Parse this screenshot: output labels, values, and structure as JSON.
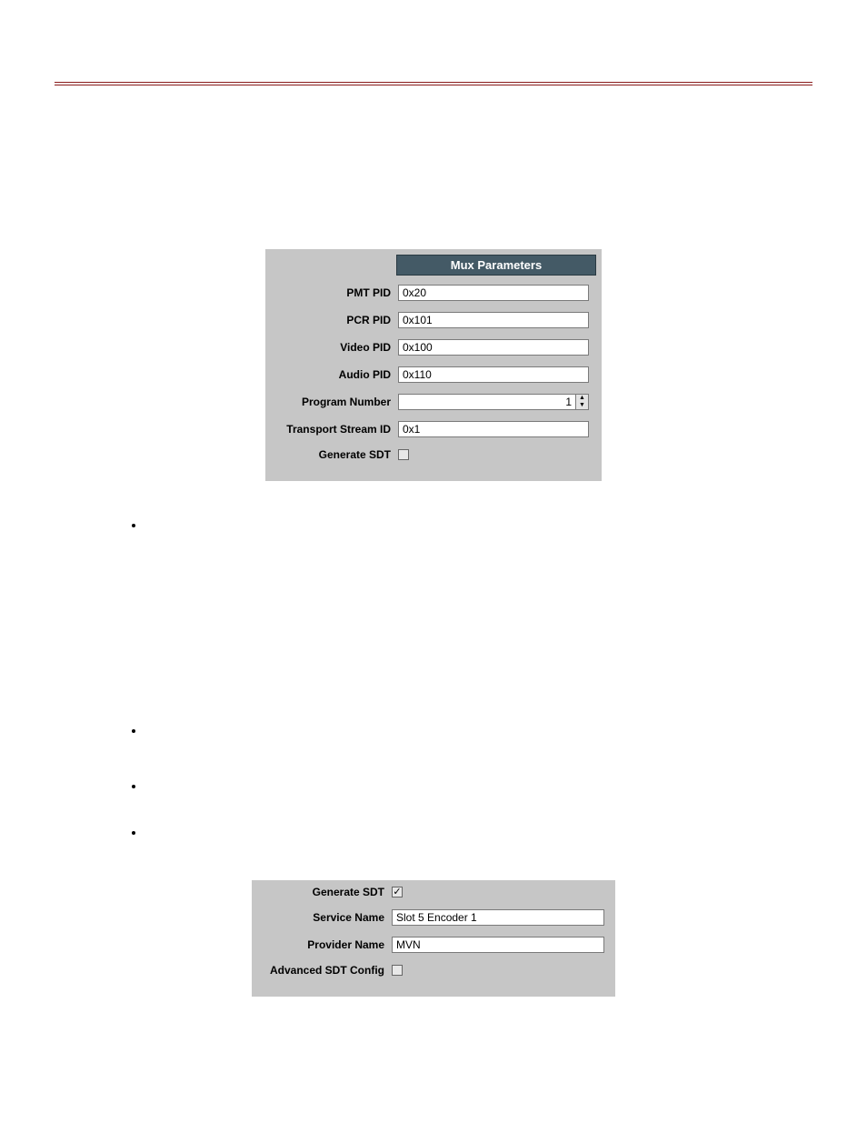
{
  "panel1": {
    "header": "Mux Parameters",
    "rows": {
      "pmt_pid": {
        "label": "PMT PID",
        "value": "0x20"
      },
      "pcr_pid": {
        "label": "PCR PID",
        "value": "0x101"
      },
      "video_pid": {
        "label": "Video PID",
        "value": "0x100"
      },
      "audio_pid": {
        "label": "Audio PID",
        "value": "0x110"
      },
      "program_number": {
        "label": "Program Number",
        "value": "1"
      },
      "transport_stream_id": {
        "label": "Transport Stream ID",
        "value": "0x1"
      },
      "generate_sdt": {
        "label": "Generate SDT",
        "checked": false
      }
    }
  },
  "panel2": {
    "rows": {
      "generate_sdt": {
        "label": "Generate SDT",
        "checked": true
      },
      "service_name": {
        "label": "Service Name",
        "value": "Slot 5 Encoder 1"
      },
      "provider_name": {
        "label": "Provider Name",
        "value": "MVN"
      },
      "advanced_sdt_config": {
        "label": "Advanced SDT Config",
        "checked": false
      }
    }
  },
  "bullets": [
    "",
    "",
    "",
    ""
  ]
}
